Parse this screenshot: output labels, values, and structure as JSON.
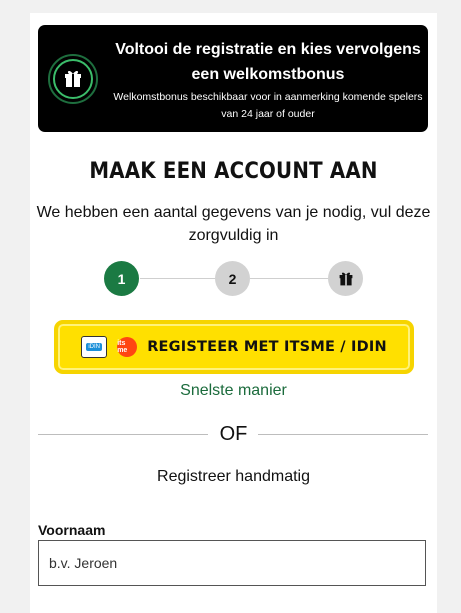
{
  "banner": {
    "title": "Voltooi de registratie en kies vervolgens een welkomstbonus",
    "subtitle": "Welkomstbonus beschikbaar voor in aanmerking komende spelers van 24 jaar of ouder",
    "icon": "gift-icon"
  },
  "heading": "MAAK EEN ACCOUNT AAN",
  "subtext": "We hebben een aantal gegevens van je nodig, vul deze zorgvuldig in",
  "stepper": {
    "steps": [
      {
        "label": "1",
        "state": "active"
      },
      {
        "label": "2",
        "state": "inactive"
      },
      {
        "icon": "gift-icon",
        "state": "inactive"
      }
    ]
  },
  "itsme_button": {
    "label": "REGISTEER MET ITSME / IDIN",
    "idin_logo_text": "iDIN",
    "itsme_logo_text": "its me"
  },
  "fastest_label": "Snelste manier",
  "or_label": "OF",
  "manual_label": "Registreer handmatig",
  "form": {
    "first_name_label": "Voornaam",
    "first_name_placeholder": "b.v. Jeroen"
  },
  "colors": {
    "banner_bg": "#000000",
    "accent_green": "#1b7a43",
    "button_yellow": "#ffe000",
    "link_green": "#1b6b3c"
  }
}
